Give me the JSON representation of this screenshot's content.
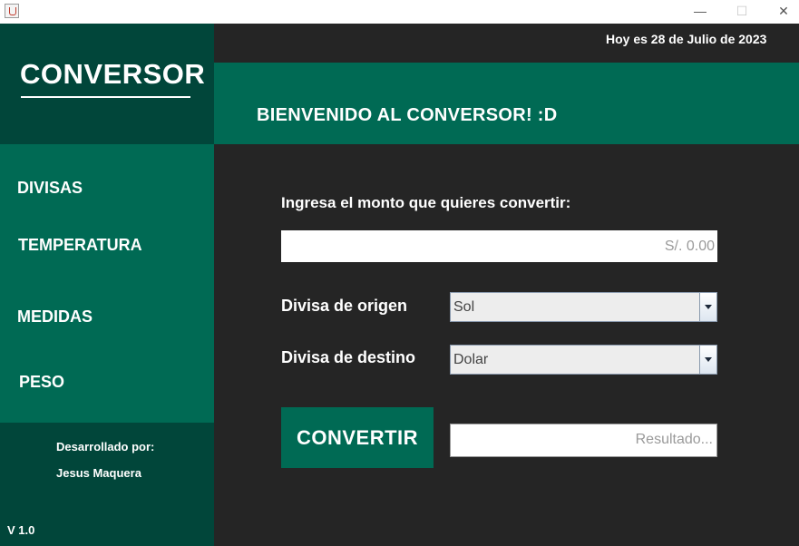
{
  "window": {
    "minimize_glyph": "—",
    "maximize_glyph": "☐",
    "close_glyph": "✕"
  },
  "sidebar": {
    "logo": "CONVERSOR",
    "menu": [
      {
        "label": "DIVISAS"
      },
      {
        "label": "TEMPERATURA"
      },
      {
        "label": "MEDIDAS"
      },
      {
        "label": "PESO"
      }
    ],
    "credits_label": "Desarrollado por:",
    "credits_name": "Jesus Maquera",
    "version": "V 1.0"
  },
  "header": {
    "date": "Hoy es 28 de Julio de 2023",
    "welcome": "BIENVENIDO AL CONVERSOR! :D"
  },
  "form": {
    "prompt": "Ingresa el monto que quieres convertir:",
    "amount_placeholder": "S/. 0.00",
    "origin_label": "Divisa de origen",
    "origin_value": "Sol",
    "destination_label": "Divisa de destino",
    "destination_value": "Dolar",
    "convert_label": "CONVERTIR",
    "result_placeholder": "Resultado..."
  },
  "colors": {
    "dark_green": "#01463a",
    "green": "#006a54",
    "background": "#252525"
  }
}
